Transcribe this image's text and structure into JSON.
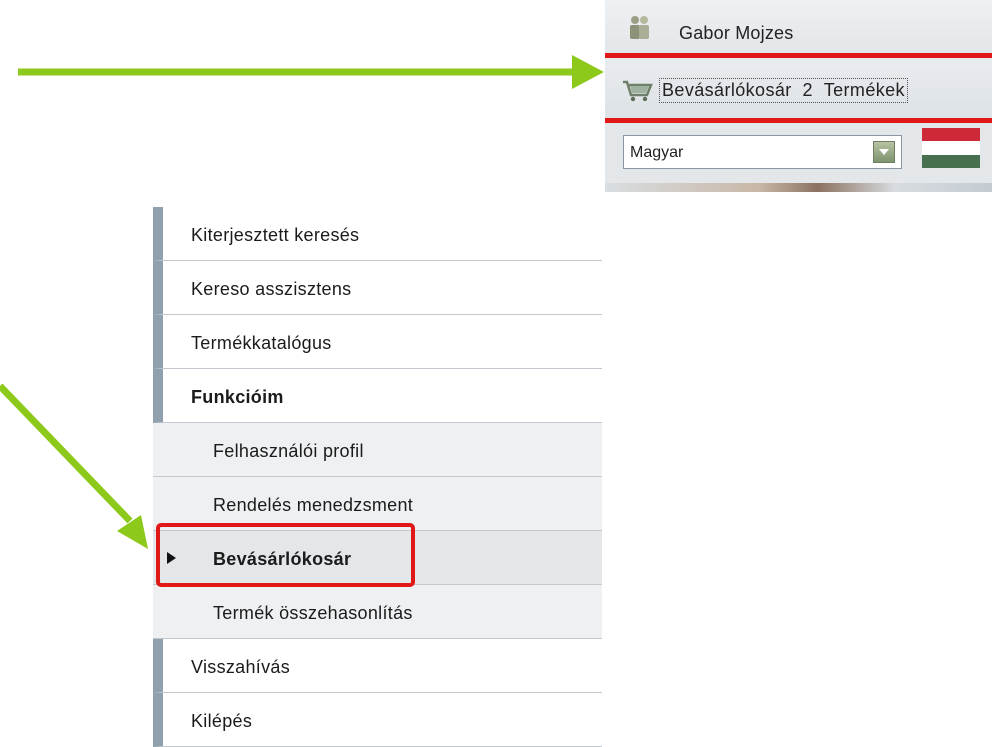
{
  "header": {
    "user_name": "Gabor Mojzes",
    "cart_label": "Bevásárlókosár",
    "cart_count": "2",
    "cart_unit": "Termékek",
    "language": {
      "selected": "Magyar"
    },
    "flag_colors": [
      "#ce2939",
      "#ffffff",
      "#477050"
    ]
  },
  "menu": {
    "items": [
      {
        "label": "Kiterjesztett keresés"
      },
      {
        "label": "Kereso asszisztens"
      },
      {
        "label": "Termékkatalógus"
      },
      {
        "label": "Funkcióim"
      },
      {
        "label": "Felhasználói profil"
      },
      {
        "label": "Rendelés menedzsment"
      },
      {
        "label": "Bevásárlókosár"
      },
      {
        "label": "Termék összehasonlítás"
      },
      {
        "label": "Visszahívás"
      },
      {
        "label": "Kilépés"
      }
    ],
    "active_index": 6
  },
  "colors": {
    "annotation_arrow": "#8cc91a",
    "highlight": "#e01818",
    "menu_accent": "#8fa0ae"
  }
}
